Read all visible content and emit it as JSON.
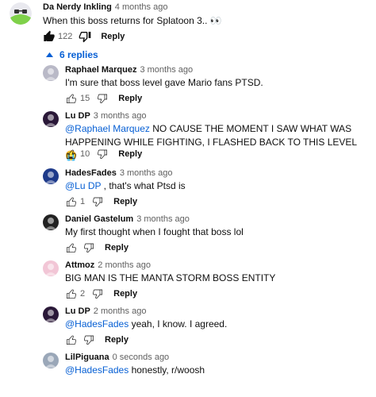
{
  "comment": {
    "author": "Da Nerdy Inkling",
    "time": "4 months ago",
    "text": "When this boss returns for Splatoon 3.. 👀",
    "likes": "122",
    "reply_label": "Reply"
  },
  "replies_toggle": {
    "label": "6 replies",
    "icon": "caret-up-icon"
  },
  "replies": [
    {
      "author": "Raphael Marquez",
      "time": "3 months ago",
      "mention": "",
      "text": "I'm sure that boss level gave Mario fans PTSD.",
      "likes": "15",
      "reply_label": "Reply",
      "avatar_color": "#b9b9c7"
    },
    {
      "author": "Lu DP",
      "time": "3 months ago",
      "mention": "@Raphael Marquez",
      "text": " NO CAUSE THE MOMENT I SAW WHAT WAS HAPPENING WHILE FIGHTING, I FLASHED BACK TO THIS LEVEL 😭",
      "likes": "10",
      "reply_label": "Reply",
      "avatar_color": "#2a1838"
    },
    {
      "author": "HadesFades",
      "time": "3 months ago",
      "mention": "@Lu DP",
      "text": " , that's what Ptsd is",
      "likes": "1",
      "reply_label": "Reply",
      "avatar_color": "#1e3a8a"
    },
    {
      "author": "Daniel Gastelum",
      "time": "3 months ago",
      "mention": "",
      "text": "My first thought when I fought that boss lol",
      "likes": "",
      "reply_label": "Reply",
      "avatar_color": "#222222"
    },
    {
      "author": "Attmoz",
      "time": "2 months ago",
      "mention": "",
      "text": "BIG MAN IS THE MANTA STORM BOSS ENTITY",
      "likes": "2",
      "reply_label": "Reply",
      "avatar_color": "#f2c6d6"
    },
    {
      "author": "Lu DP",
      "time": "2 months ago",
      "mention": "@HadesFades",
      "text": " yeah, I know. I agreed.",
      "likes": "",
      "reply_label": "Reply",
      "avatar_color": "#2a1838"
    },
    {
      "author": "LilPiguana",
      "time": "0 seconds ago",
      "mention": "@HadesFades",
      "text": " honestly, r/woosh",
      "likes": "",
      "reply_label": "",
      "avatar_color": "#9aa7b8"
    }
  ]
}
